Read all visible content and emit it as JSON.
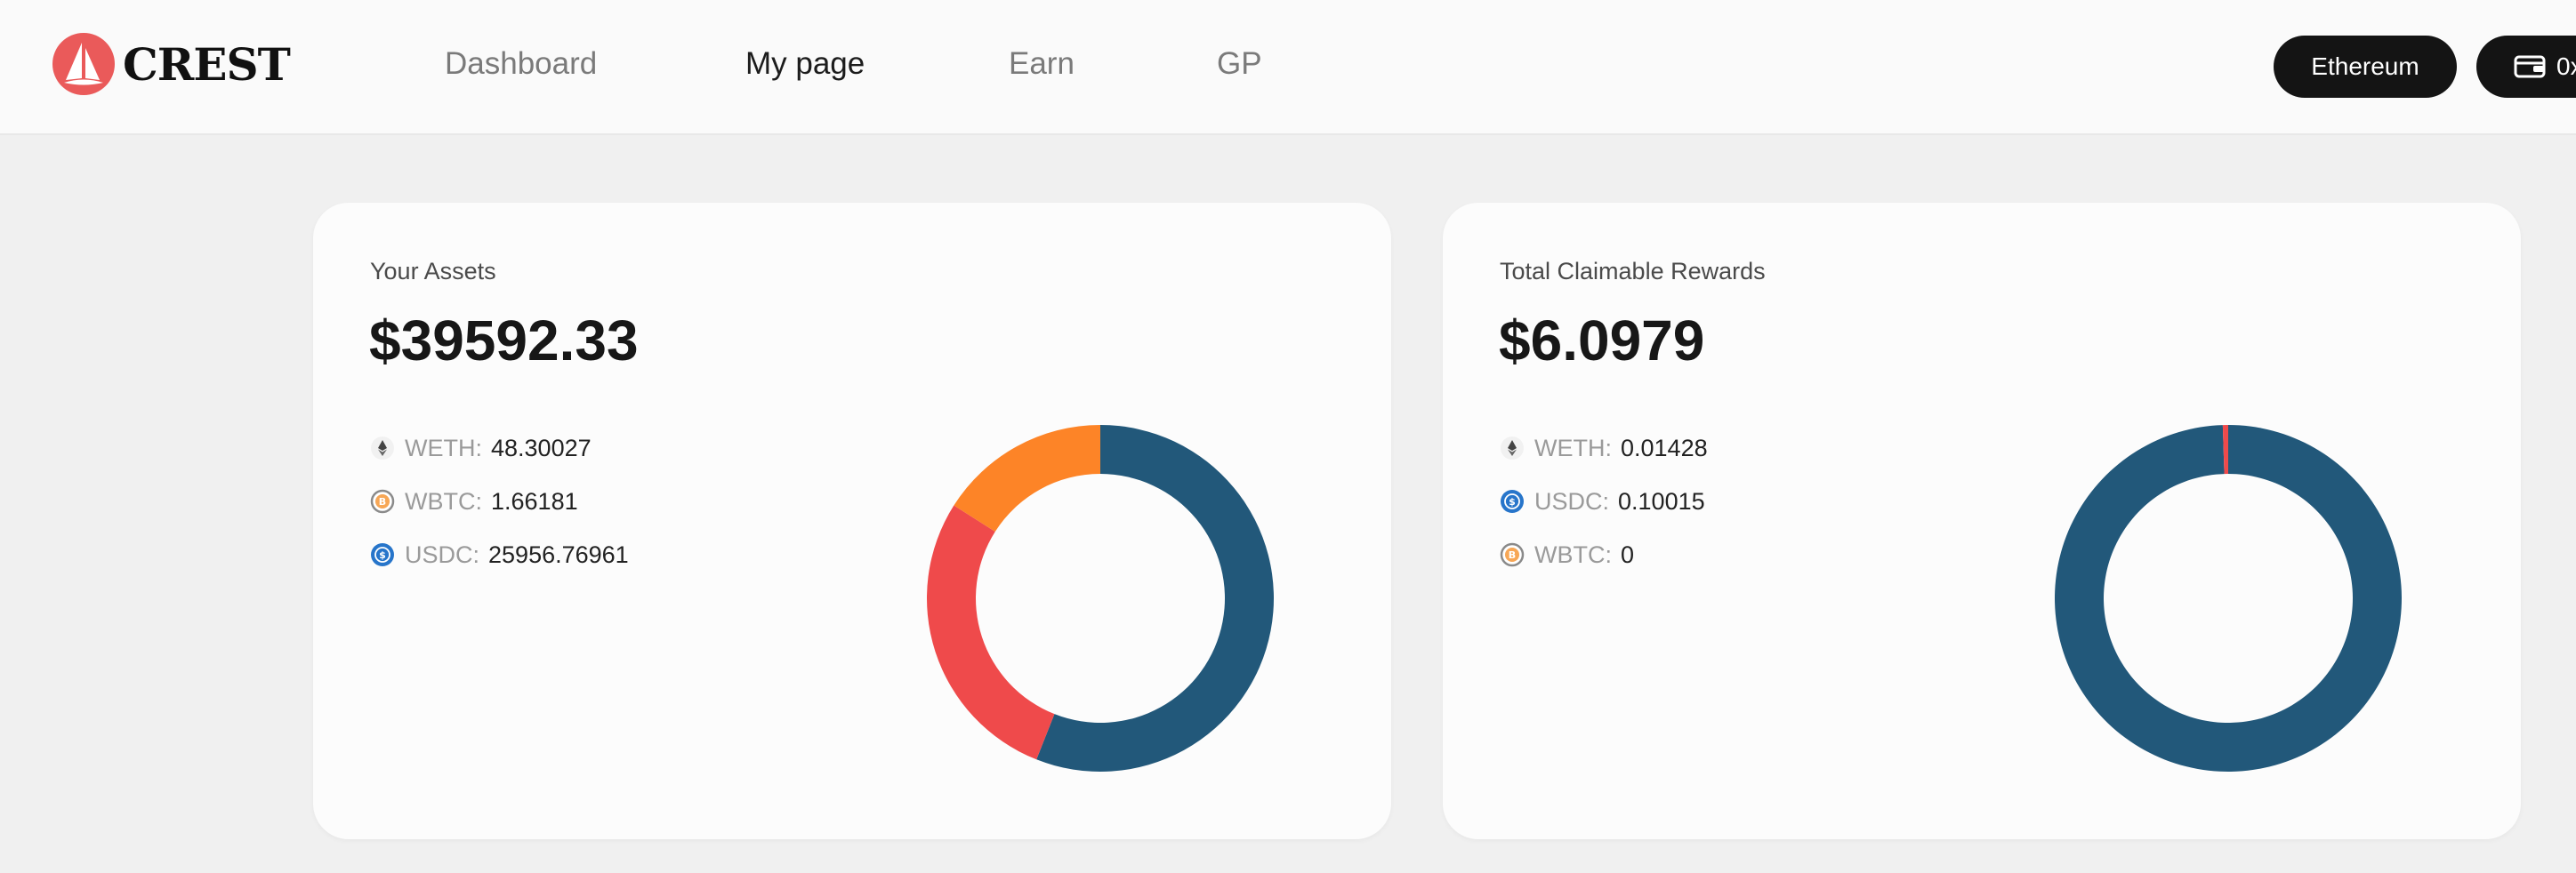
{
  "brand": {
    "name": "CREST"
  },
  "nav": [
    {
      "label": "Dashboard",
      "active": false
    },
    {
      "label": "My page",
      "active": true
    },
    {
      "label": "Earn",
      "active": false
    },
    {
      "label": "GP",
      "active": false
    }
  ],
  "header": {
    "network": "Ethereum",
    "wallet_label": "0x"
  },
  "assets_card": {
    "title": "Your Assets",
    "amount": "$39592.33",
    "items": [
      {
        "symbol": "WETH:",
        "value": "48.30027",
        "icon": "ethereum-icon"
      },
      {
        "symbol": "WBTC:",
        "value": "1.66181",
        "icon": "bitcoin-icon"
      },
      {
        "symbol": "USDC:",
        "value": "25956.76961",
        "icon": "usdc-icon"
      }
    ]
  },
  "rewards_card": {
    "title": "Total Claimable Rewards",
    "amount": "$6.0979",
    "items": [
      {
        "symbol": "WETH:",
        "value": "0.01428",
        "icon": "ethereum-icon"
      },
      {
        "symbol": "USDC:",
        "value": "0.10015",
        "icon": "usdc-icon"
      },
      {
        "symbol": "WBTC:",
        "value": "0",
        "icon": "bitcoin-icon"
      }
    ]
  },
  "colors": {
    "usdc": "#22587a",
    "wbtc": "#ef4a4b",
    "weth": "#fd8427",
    "dark": "#141414",
    "brand": "#ea5a5a"
  },
  "chart_data": [
    {
      "type": "pie",
      "categories": [
        "USDC",
        "WBTC",
        "WETH"
      ],
      "values": [
        56,
        28,
        16
      ]
    },
    {
      "type": "pie",
      "categories": [
        "USDC",
        "WBTC",
        "WETH"
      ],
      "values": [
        99.5,
        0.5,
        0
      ]
    }
  ]
}
